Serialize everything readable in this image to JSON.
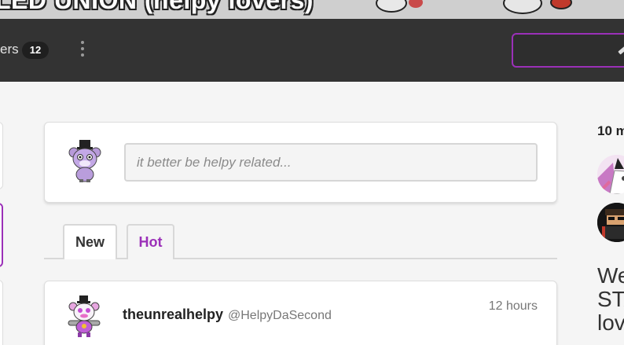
{
  "banner": {
    "title": "LED UNION (helpy lovers)"
  },
  "navbar": {
    "members_label": "ers",
    "members_count": "12",
    "more_icon": "vertical-ellipsis-icon",
    "create_icon": "pencil-icon",
    "accent_color": "#9b30b8"
  },
  "composer": {
    "placeholder": "it better be helpy related...",
    "avatar_icon": "helpy-avatar-icon"
  },
  "tabs": [
    {
      "label": "New",
      "active": false
    },
    {
      "label": "Hot",
      "active": true
    }
  ],
  "post": {
    "username": "theunrealhelpy",
    "handle": "@HelpyDaSecond",
    "time": "12 hours",
    "avatar_icon": "funtime-helpy-avatar-icon"
  },
  "sidebar": {
    "online_label": "10 m",
    "text_lines": [
      "We",
      "STA",
      "lov"
    ]
  },
  "colors": {
    "navbar_bg": "#333333",
    "page_bg": "#f5f5f5",
    "accent": "#9b30b8"
  }
}
